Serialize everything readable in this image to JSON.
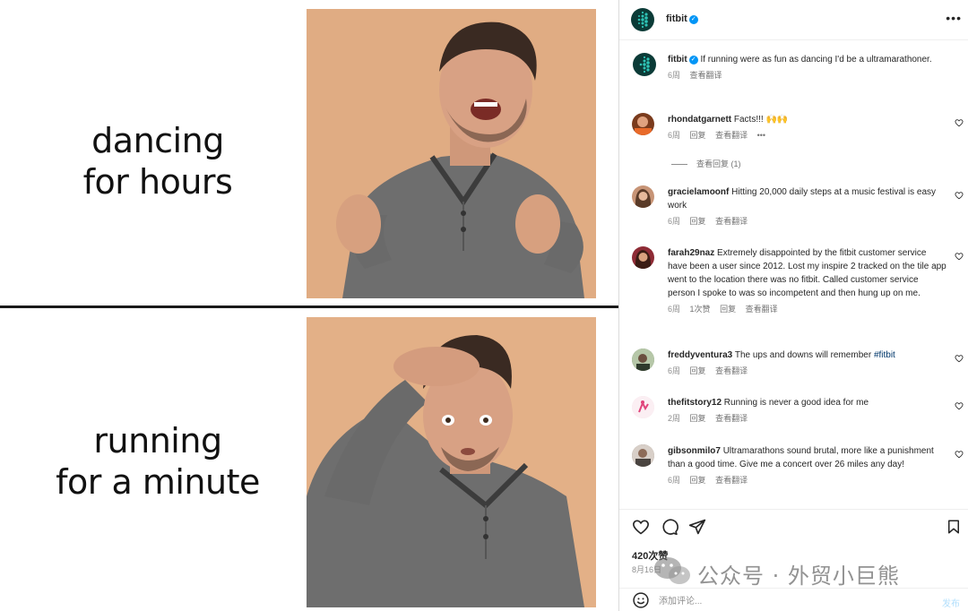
{
  "meme": {
    "top_caption_line1": "dancing",
    "top_caption_line2": "for hours",
    "bottom_caption_line1": "running",
    "bottom_caption_line2": "for a minute"
  },
  "post": {
    "username": "fitbit",
    "verified": true,
    "caption_username": "fitbit",
    "caption_text": "If running were as fun as dancing I'd be a ultramarathoner.",
    "caption_age": "6周",
    "caption_translate": "查看翻译"
  },
  "comments": [
    {
      "username": "rhondatgarnett",
      "text": "Facts!!! 🙌🙌",
      "age": "6周",
      "likes": "",
      "reply": "回复",
      "translate": "查看翻译",
      "more": "•••",
      "avatar_color": "#7a3b1d"
    },
    {
      "username": "gracielamoonf",
      "text": "Hitting 20,000 daily steps at a music festival is easy work",
      "age": "6周",
      "likes": "",
      "reply": "回复",
      "translate": "查看翻译",
      "avatar_color": "#c79476"
    },
    {
      "username": "farah29naz",
      "text": "Extremely disappointed by the fitbit customer service have been a user since 2012. Lost my inspire 2 tracked on the tile app went to the location there was no fitbit. Called customer service person I spoke to was so incompetent and then hung up on me.",
      "age": "6周",
      "likes": "1次赞",
      "reply": "回复",
      "translate": "查看翻译",
      "avatar_color": "#8e2b35"
    },
    {
      "username": "freddyventura3",
      "text": "The ups and downs will remember ",
      "hashtag": "#fitbit",
      "age": "6周",
      "likes": "",
      "reply": "回复",
      "translate": "查看翻译",
      "avatar_color": "#6f8a6a"
    },
    {
      "username": "thefitstory12",
      "text": "Running is never a good idea for me",
      "age": "2周",
      "likes": "",
      "reply": "回复",
      "translate": "查看翻译",
      "avatar_color": "#f3dfe6"
    },
    {
      "username": "gibsonmilo7",
      "text": "Ultramarathons sound brutal, more like a punishment than a good time. Give me a concert over 26 miles any day!",
      "age": "6周",
      "likes": "",
      "reply": "回复",
      "translate": "查看翻译",
      "avatar_color": "#8a7d74"
    }
  ],
  "view_replies": "查看回复 (1)",
  "actions": {
    "likes": "420次赞",
    "date": "8月16日"
  },
  "add_comment": {
    "placeholder": "添加评论...",
    "post_label": "发布"
  },
  "watermark": "公众号 · 外贸小巨熊",
  "colors": {
    "fitbit_teal": "#0b3b37",
    "verified_blue": "#0095f6",
    "photo_background": "#e3b087",
    "hashtag": "#00376b"
  }
}
